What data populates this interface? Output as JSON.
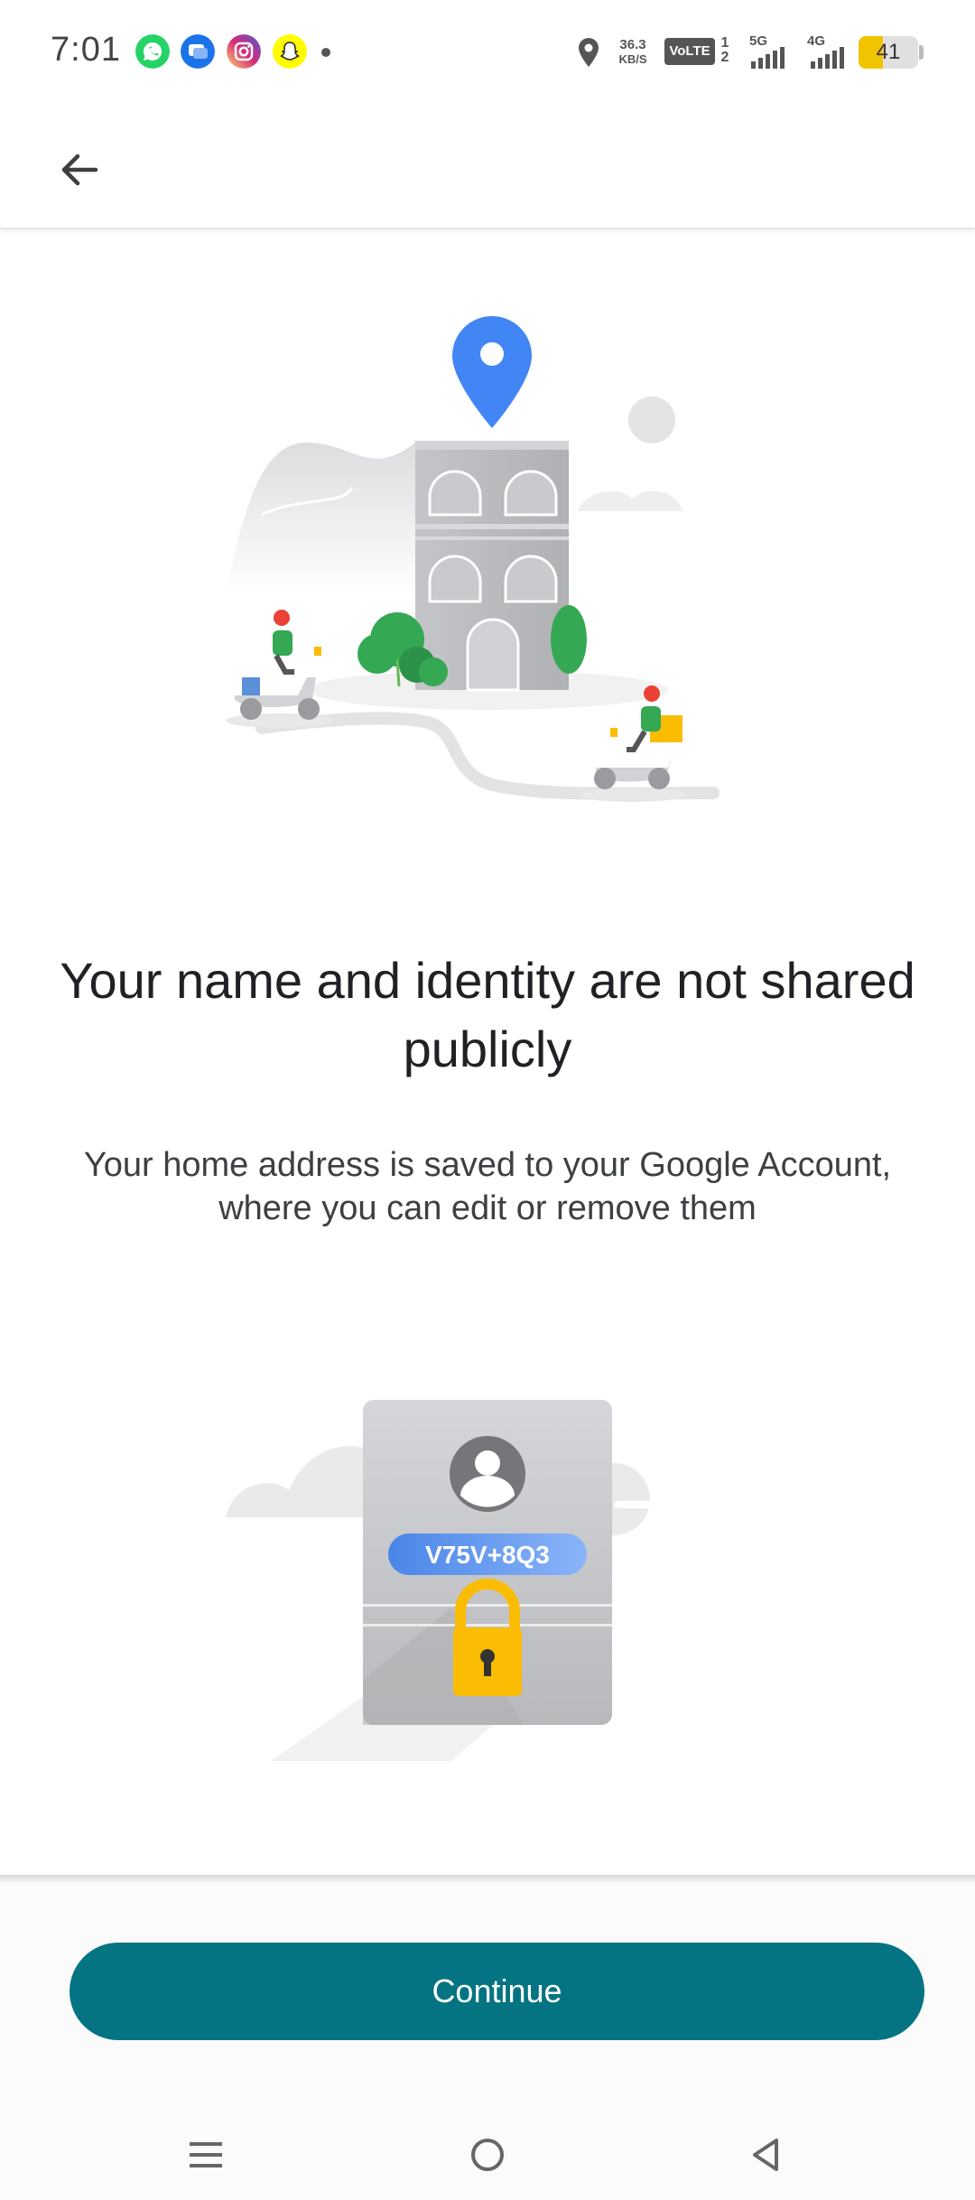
{
  "status_bar": {
    "time": "7:01",
    "apps": [
      {
        "icon": "whatsapp-icon",
        "color": "#25D366"
      },
      {
        "icon": "messages-icon",
        "color": "#1A73E8"
      },
      {
        "icon": "instagram-icon",
        "color": "#E1306C"
      },
      {
        "icon": "snapchat-icon",
        "color": "#FFFC00"
      }
    ],
    "speed_value": "36.3",
    "speed_unit": "KB/S",
    "volte": "VoLTE",
    "sim_1": "1",
    "sim_2": "2",
    "net_1": "5G",
    "net_2": "4G",
    "battery_level": "41",
    "battery_fraction": 0.41
  },
  "app_bar": {
    "back_icon": "arrow-left-icon"
  },
  "illustration_top": {
    "pin_color": "#4285F4",
    "tree_color": "#34A853"
  },
  "main": {
    "headline": "Your name and identity are not shared publicly",
    "subtext": "Your home address is saved to your Google Account, where you can edit or remove them"
  },
  "illustration_bottom": {
    "plus_code": "V75V+8Q3",
    "lock_color": "#FBBC04"
  },
  "footer": {
    "continue_label": "Continue",
    "button_color": "#047482"
  },
  "nav_bar": {
    "items": [
      "menu-icon",
      "home-icon",
      "back-triangle-icon"
    ]
  }
}
